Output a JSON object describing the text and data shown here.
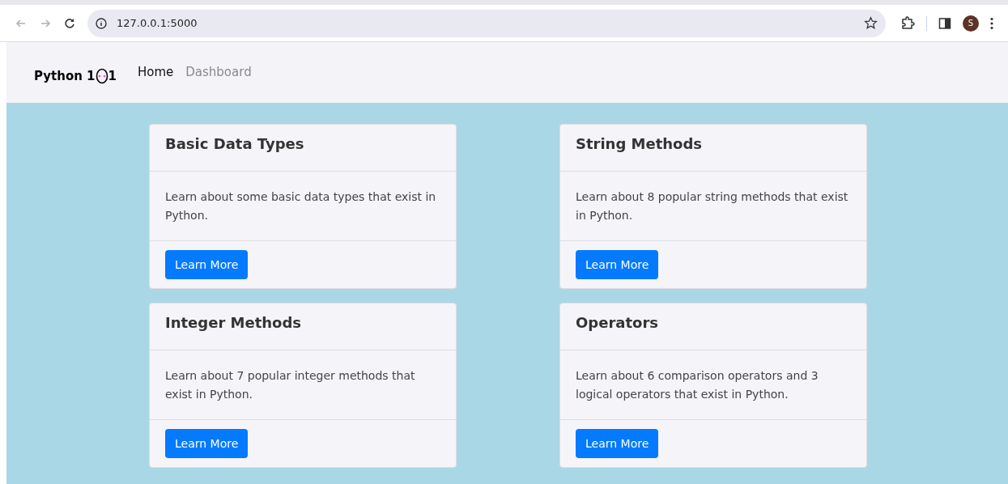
{
  "browser": {
    "url": "127.0.0.1:5000",
    "profile_initial": "S"
  },
  "navbar": {
    "brand_parts": [
      "Python 1",
      "1"
    ],
    "links": [
      {
        "label": "Home",
        "selected": true
      },
      {
        "label": "Dashboard",
        "selected": false
      }
    ]
  },
  "cards": [
    {
      "title": "Basic Data Types",
      "text": "Learn about some basic data types that exist in Python.",
      "button": "Learn More"
    },
    {
      "title": "String Methods",
      "text": "Learn about 8 popular string methods that exist in Python.",
      "button": "Learn More"
    },
    {
      "title": "Integer Methods",
      "text": "Learn about 7 popular integer methods that exist in Python.",
      "button": "Learn More"
    },
    {
      "title": "Operators",
      "text": "Learn about 6 comparison operators and 3 logical operators that exist in Python.",
      "button": "Learn More"
    }
  ]
}
